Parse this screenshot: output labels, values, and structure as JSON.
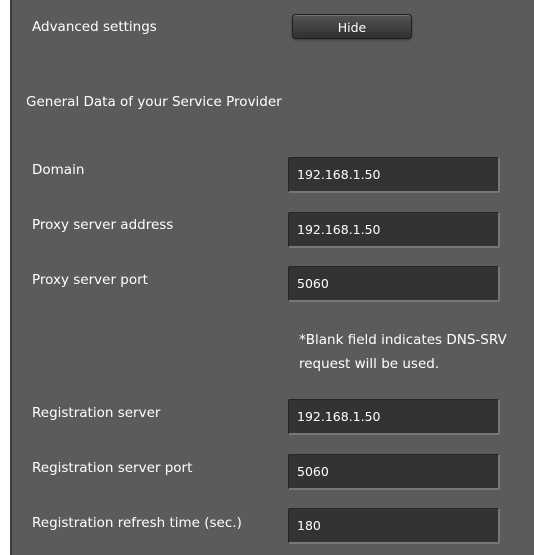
{
  "advanced": {
    "label": "Advanced settings",
    "hide_button": "Hide"
  },
  "section": {
    "title": "General Data of your Service Provider"
  },
  "fields": [
    {
      "label": "Domain",
      "value": "192.168.1.50"
    },
    {
      "label": "Proxy server address",
      "value": "192.168.1.50"
    },
    {
      "label": "Proxy server port",
      "value": "5060"
    },
    {
      "label": "Registration server",
      "value": "192.168.1.50"
    },
    {
      "label": "Registration server port",
      "value": "5060"
    },
    {
      "label": "Registration refresh time (sec.)",
      "value": "180"
    }
  ],
  "note": "*Blank field indicates DNS-SRV request will be used."
}
